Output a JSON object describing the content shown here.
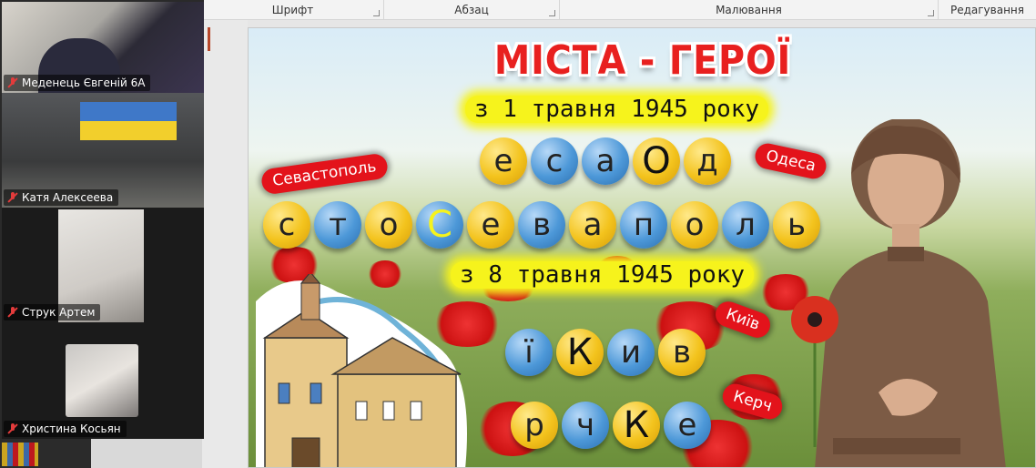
{
  "ribbon": {
    "groups": [
      "Шрифт",
      "Абзац",
      "Малювання",
      "Редагування"
    ]
  },
  "participants": [
    {
      "name": "Меденець Євгеній 6А"
    },
    {
      "name": "Катя Алексеева"
    },
    {
      "name": "Струк Артем"
    },
    {
      "name": "Христина Косьян"
    }
  ],
  "slide": {
    "title": "МІСТА - ГЕРОЇ",
    "date1": "з 1 травня 1945 року",
    "date2": "з 8 травня 1945 року",
    "word_odesa": [
      "е",
      "с",
      "а",
      "О",
      "д"
    ],
    "word_sevastopol": [
      "с",
      "т",
      "о",
      "С",
      "е",
      "в",
      "а",
      "п",
      "о",
      "л",
      "ь"
    ],
    "word_kyiv": [
      "ї",
      "К",
      "и",
      "в"
    ],
    "word_kerch": [
      "р",
      "ч",
      "К",
      "е"
    ],
    "tag_odesa": "Одеса",
    "tag_sevastopol": "Севастополь",
    "tag_kyiv": "Київ",
    "tag_kerch": "Керч"
  },
  "colors": {
    "title_red": "#e8201f",
    "ball_yellow": "#f3c31d",
    "ball_blue": "#4d98d8",
    "tag_red": "#e3131b",
    "date_highlight": "#f6f31c"
  }
}
